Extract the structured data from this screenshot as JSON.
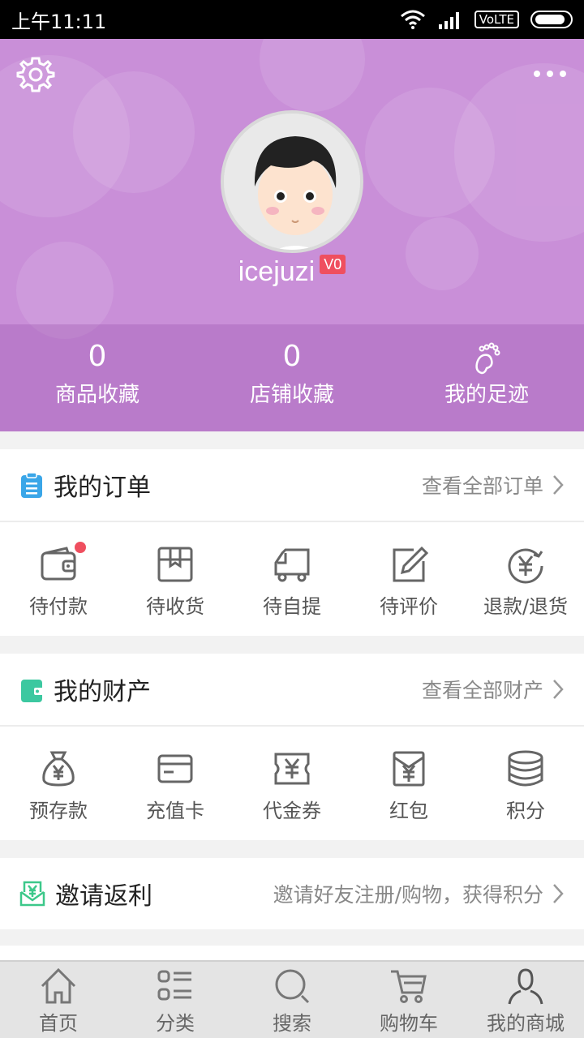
{
  "status_bar": {
    "time": "上午11:11",
    "network": "VoLTE"
  },
  "profile": {
    "username": "icejuzi",
    "level": "V0"
  },
  "stats": [
    {
      "value": "0",
      "label": "商品收藏"
    },
    {
      "value": "0",
      "label": "店铺收藏"
    },
    {
      "label": "我的足迹",
      "icon": "footprint-icon"
    }
  ],
  "orders": {
    "title": "我的订单",
    "link": "查看全部订单",
    "items": [
      {
        "label": "待付款",
        "icon": "wallet-icon",
        "has_dot": true
      },
      {
        "label": "待收货",
        "icon": "package-icon"
      },
      {
        "label": "待自提",
        "icon": "truck-icon"
      },
      {
        "label": "待评价",
        "icon": "edit-icon"
      },
      {
        "label": "退款/退货",
        "icon": "refund-icon"
      }
    ]
  },
  "assets": {
    "title": "我的财产",
    "link": "查看全部财产",
    "items": [
      {
        "label": "预存款",
        "icon": "money-bag-icon"
      },
      {
        "label": "充值卡",
        "icon": "card-icon"
      },
      {
        "label": "代金券",
        "icon": "voucher-icon"
      },
      {
        "label": "红包",
        "icon": "red-envelope-icon"
      },
      {
        "label": "积分",
        "icon": "coins-icon"
      }
    ]
  },
  "invite": {
    "title": "邀请返利",
    "link": "邀请好友注册/购物，获得积分"
  },
  "tabs": [
    {
      "label": "首页",
      "icon": "home-icon"
    },
    {
      "label": "分类",
      "icon": "category-icon"
    },
    {
      "label": "搜索",
      "icon": "search-icon"
    },
    {
      "label": "购物车",
      "icon": "cart-icon"
    },
    {
      "label": "我的商城",
      "icon": "user-icon"
    }
  ],
  "colors": {
    "header": "#c98fd8",
    "badge": "#ef4f5f",
    "order_icon": "#3aa6e8",
    "asset_icon": "#3cc8a0",
    "invite_icon": "#3cc88a"
  }
}
